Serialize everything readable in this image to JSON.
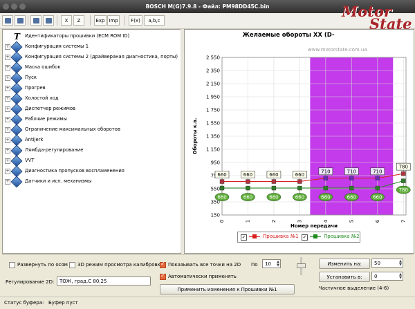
{
  "window": {
    "title": "BOSCH M(G)7.9.8 - Файл: PM98DD45C.bin"
  },
  "toolbar": {
    "x_label": "X",
    "z_label": "Z",
    "exp_label": "Exp",
    "imp_label": "Imp",
    "fx_label": "F(x)",
    "abc_label": "a,b,c"
  },
  "logo": {
    "line1": "Motor",
    "line2": "State"
  },
  "tree": {
    "items": [
      {
        "label": "Идентификаторы прошивки (ECM ROM ID)",
        "type": "text"
      },
      {
        "label": "Конфигурация системы 1",
        "type": "group"
      },
      {
        "label": "Конфигурация системы 2 (драйвераная диагностика, порты)",
        "type": "group"
      },
      {
        "label": "Маска ошибок",
        "type": "group"
      },
      {
        "label": "Пуск",
        "type": "group"
      },
      {
        "label": "Прогрев",
        "type": "group"
      },
      {
        "label": "Холостой ход",
        "type": "group"
      },
      {
        "label": "Диспетчер режимов",
        "type": "group"
      },
      {
        "label": "Рабочие режимы",
        "type": "group"
      },
      {
        "label": "Ограничение максимальных оборотов",
        "type": "group"
      },
      {
        "label": "AntiJerk",
        "type": "group"
      },
      {
        "label": "Лямбда-регулирование",
        "type": "group"
      },
      {
        "label": "VVT",
        "type": "group"
      },
      {
        "label": "Диагностика пропусков воспламенения",
        "type": "group"
      },
      {
        "label": "Датчики и исп. механизмы",
        "type": "group"
      }
    ]
  },
  "chart_data": {
    "type": "line",
    "title": "Желаемые обороты ХХ (D-",
    "watermark": "www.motorstate.com.ua",
    "xlabel": "Номер передачи",
    "ylabel": "Обороты к.в.",
    "x": [
      0,
      1,
      2,
      3,
      4,
      5,
      6,
      7
    ],
    "ylim": [
      150,
      2550
    ],
    "yticks": [
      150,
      350,
      550,
      750,
      950,
      1150,
      1350,
      1550,
      1750,
      1950,
      2150,
      2350,
      2550
    ],
    "ytick_labels": [
      "150",
      "350",
      "550",
      "750",
      "950",
      "1 150",
      "1 350",
      "1 550",
      "1 750",
      "1 950",
      "2 150",
      "2 350",
      "2 550"
    ],
    "highlight": {
      "from": 3.4,
      "to": 6.6,
      "color": "#c33bea"
    },
    "grid": true,
    "series": [
      {
        "name": "Прошивка №1",
        "values": [
          660,
          660,
          660,
          660,
          710,
          710,
          710,
          780
        ],
        "color": "#d81e1e",
        "marker_color": "#b0333d",
        "sel_color": "#6a2bb5",
        "label_bg": "#ffffee",
        "label_bg_sel": "#efe7ff",
        "label_pos": "above"
      },
      {
        "name": "Прошивка №2",
        "values": [
          560,
          560,
          560,
          560,
          560,
          560,
          560,
          670
        ],
        "color": "#1e8a1e",
        "marker_color": "#2f7b2a",
        "label_bg": "#5fae3a",
        "label_pos": "below",
        "labels": [
          "660",
          "660",
          "660",
          "660",
          "660",
          "660",
          "660",
          "780"
        ]
      }
    ]
  },
  "controls": {
    "expand_axes": "Развернуть по осям",
    "view_3d": "3D режим просмотра калибровки",
    "show_all_2d": "Показывать все точки на 2D",
    "auto_apply": "Автоматически применять",
    "po_label": "По",
    "po_value": "10",
    "reg2d_label": "Регулирование 2D:",
    "reg2d_value": "ТОЖ, град.С 80,25",
    "apply_button": "Применить изменения к Прошивки №1",
    "change_button": "Изменить на:",
    "change_value": "50",
    "set_button": "Установить в:",
    "set_value": "0",
    "partial": "Частичное выделение (4-6)"
  },
  "status": {
    "buffer_label": "Статус буфера:",
    "buffer_value": "Буфер пуст"
  }
}
